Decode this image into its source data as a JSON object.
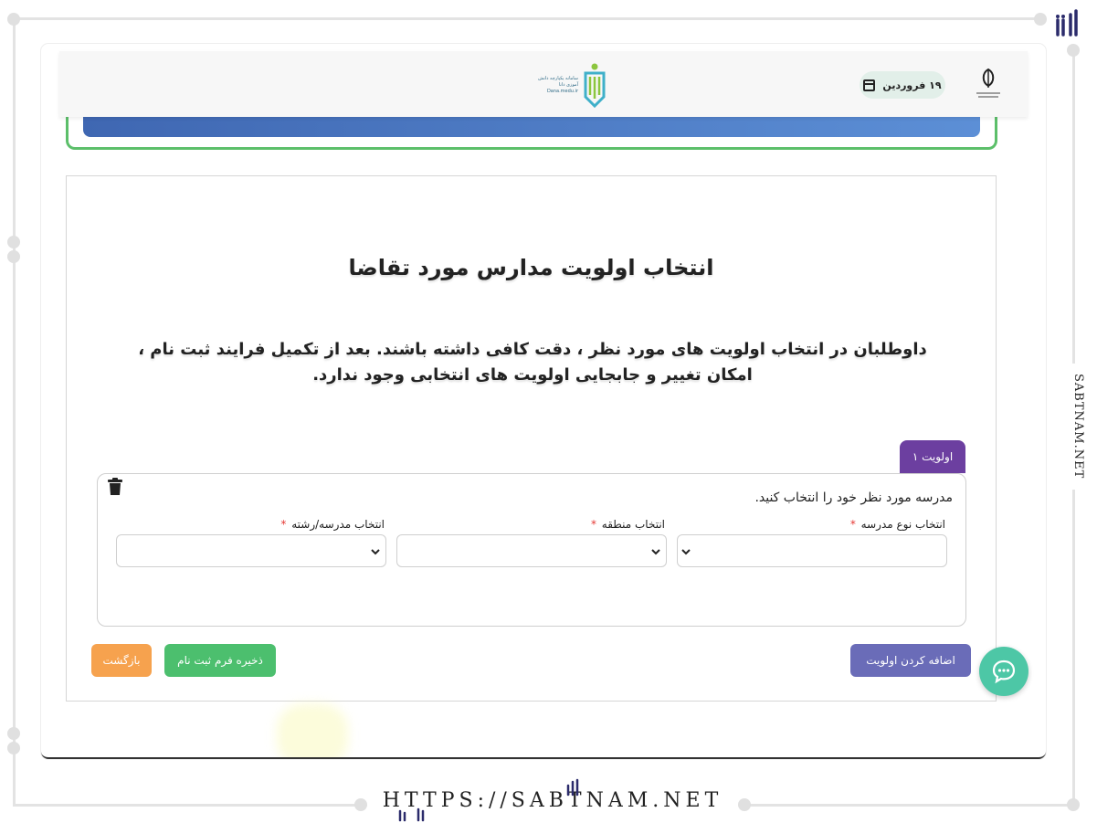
{
  "watermark": {
    "side_text": "SABTNAM.NET",
    "bottom_url": "HTTPS://SABTNAM.NET"
  },
  "header": {
    "date_label": "۱۹ فروردین",
    "logo_text": "سامانه یکپارچه دانش آموزی دانا Dana.medu.ir",
    "emblem_icon": "iran-emblem-icon"
  },
  "page": {
    "title": "انتخاب اولویت مدارس مورد تقاضا",
    "warning": "داوطلبان در انتخاب اولویت های مورد نظر ، دقت کافی داشته باشند. بعد از تکمیل فرایند ثبت نام ، امکان تغییر و جابجایی اولویت های انتخابی وجود ندارد."
  },
  "priority": {
    "tab_label": "اولویت ۱",
    "caption": "مدرسه مورد نظر خود را انتخاب کنید.",
    "fields": [
      {
        "label": "انتخاب نوع مدرسه",
        "required": "*",
        "value": ""
      },
      {
        "label": "انتخاب منطقه",
        "required": "*",
        "value": ""
      },
      {
        "label": "انتخاب مدرسه/رشته",
        "required": "*",
        "value": ""
      }
    ]
  },
  "actions": {
    "add_priority": "اضافه کردن اولویت",
    "save_form": "ذخیره فرم ثبت نام",
    "back": "بازگشت"
  },
  "colors": {
    "tab": "#6c3fa0",
    "add_button": "#6a6cb8",
    "save_button": "#4cbf6e",
    "back_button": "#f6a24e",
    "chat_button": "#4dc7a6",
    "required": "#e53935"
  }
}
